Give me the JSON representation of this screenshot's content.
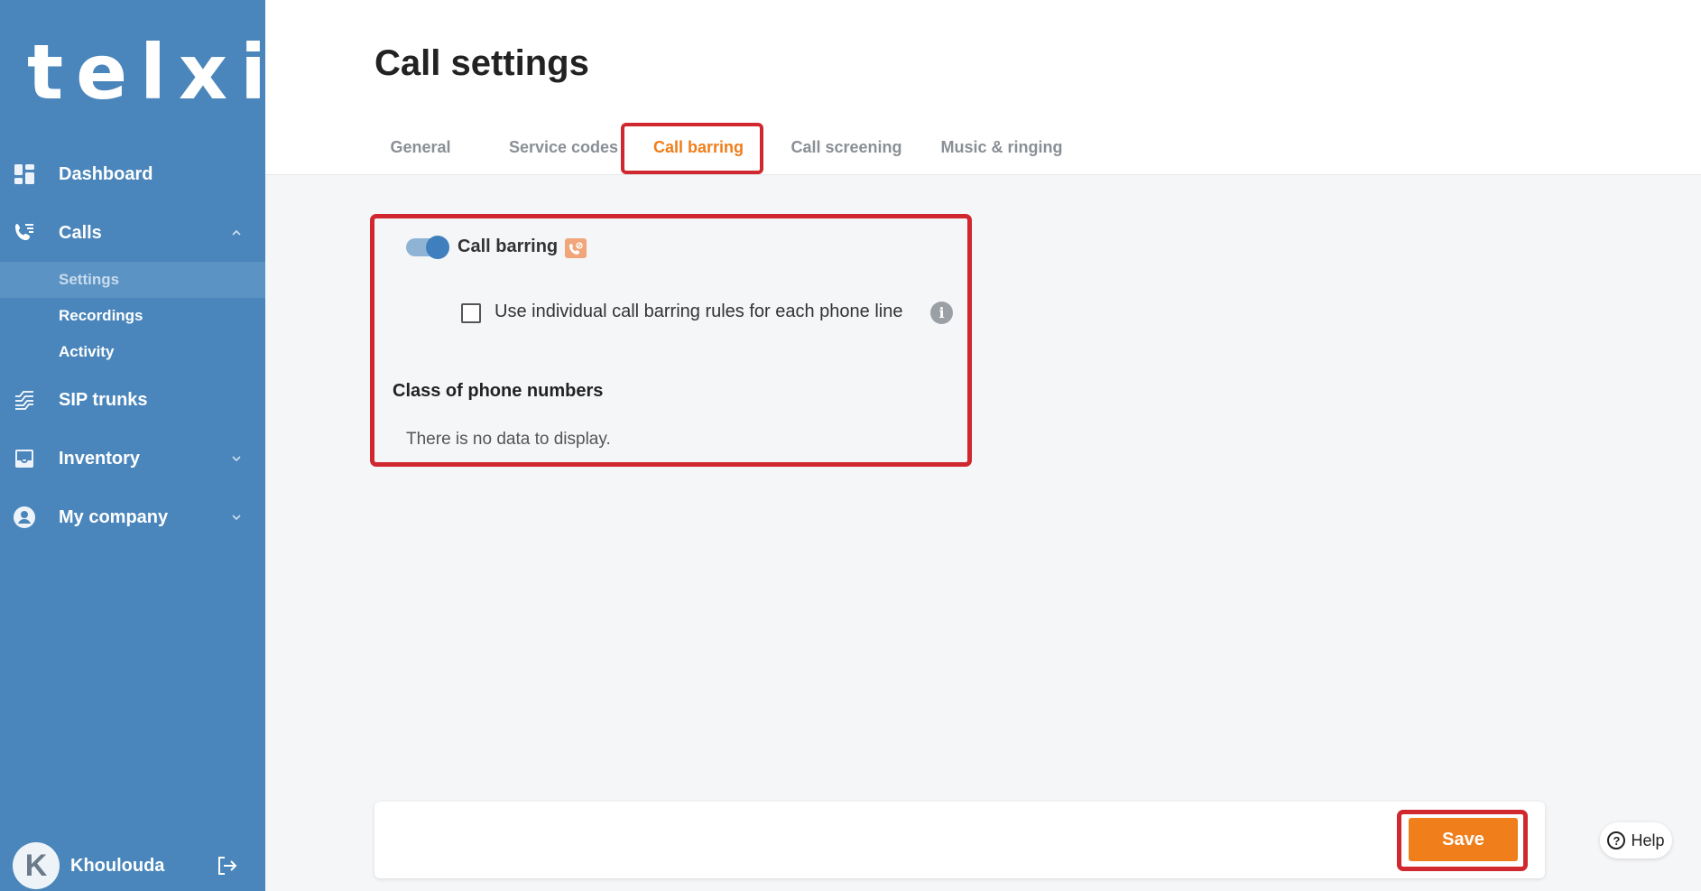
{
  "sidebar": {
    "logo": "telxi",
    "items": [
      {
        "label": "Dashboard",
        "icon": "dashboard-icon"
      },
      {
        "label": "Calls",
        "icon": "phone-list-icon"
      },
      {
        "label": "SIP trunks",
        "icon": "sip-trunks-icon"
      },
      {
        "label": "Inventory",
        "icon": "inbox-icon"
      },
      {
        "label": "My company",
        "icon": "account-circle-icon"
      }
    ],
    "calls_subitems": [
      {
        "label": "Settings",
        "active": true
      },
      {
        "label": "Recordings",
        "active": false
      },
      {
        "label": "Activity",
        "active": false
      }
    ],
    "user": {
      "initial": "K",
      "name": "Khoulouda"
    }
  },
  "header": {
    "title": "Call settings",
    "tabs": [
      {
        "label": "General",
        "active": false
      },
      {
        "label": "Service codes",
        "active": false
      },
      {
        "label": "Call barring",
        "active": true
      },
      {
        "label": "Call screening",
        "active": false
      },
      {
        "label": "Music & ringing",
        "active": false
      }
    ]
  },
  "call_barring": {
    "toggle_label": "Call barring",
    "toggle_on": true,
    "checkbox_label": "Use individual call barring rules for each phone line",
    "checkbox_checked": false,
    "info_glyph": "i",
    "class_heading": "Class of phone numbers",
    "empty_text": "There is no data to display."
  },
  "footer": {
    "save_label": "Save"
  },
  "help": {
    "label": "Help",
    "glyph": "?"
  },
  "colors": {
    "sidebar": "#4a86bb",
    "accent": "#ef7d19",
    "highlight": "#d0282e",
    "toggle": "#3f7fbd"
  }
}
